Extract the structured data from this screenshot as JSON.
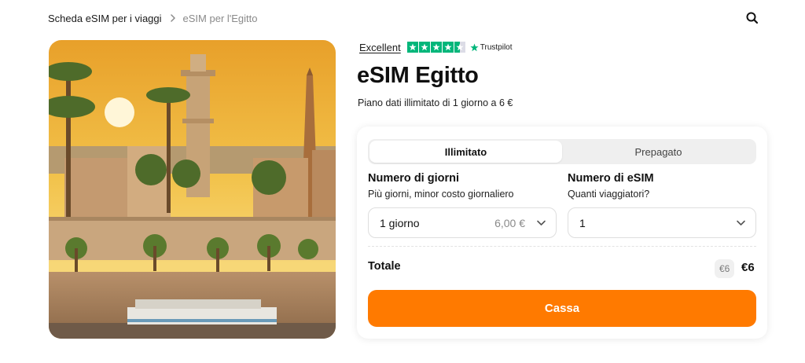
{
  "breadcrumb": {
    "home": "Scheda eSIM per i viaggi",
    "current": "eSIM per l'Egitto"
  },
  "icons": {
    "search": "search-icon",
    "breadcrumb_sep": "chevron-right-icon",
    "chevron": "chevron-down-icon",
    "star": "star-icon"
  },
  "rating": {
    "label": "Excellent",
    "stars": 4.5,
    "brand": "Trustpilot"
  },
  "product": {
    "title": "eSIM Egitto",
    "subtitle": "Piano dati illimitato di 1 giorno a 6 €"
  },
  "tabs": [
    {
      "label": "Illimitato",
      "active": true
    },
    {
      "label": "Prepagato",
      "active": false
    }
  ],
  "days": {
    "title": "Numero di giorni",
    "subtitle": "Più giorni, minor costo giornaliero",
    "value": "1 giorno",
    "price": "6,00 €"
  },
  "esims": {
    "title": "Numero di eSIM",
    "subtitle": "Quanti viaggiatori?",
    "value": "1"
  },
  "total": {
    "label": "Totale",
    "old_price": "€6",
    "price": "€6"
  },
  "checkout": {
    "label": "Cassa"
  },
  "colors": {
    "accent": "#ff7a00",
    "trustpilot": "#00b67a"
  }
}
